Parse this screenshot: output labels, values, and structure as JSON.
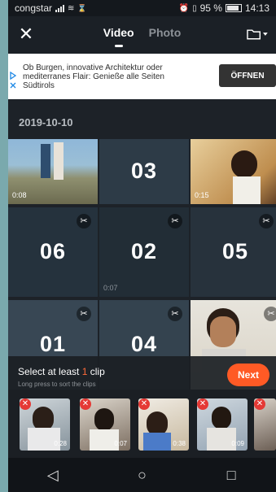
{
  "status_bar": {
    "carrier": "congstar",
    "battery_pct": "95 %",
    "time": "14:13"
  },
  "top_bar": {
    "tabs": [
      {
        "label": "Video",
        "active": true
      },
      {
        "label": "Photo",
        "active": false
      }
    ],
    "close_icon": "close-icon",
    "folder_icon": "folder-dropdown-icon"
  },
  "ad": {
    "text": "Ob Burgen, innovative Architektur oder mediterranes Flair: Genieße alle Seiten Südtirols",
    "button": "ÖFFNEN"
  },
  "date_header": "2019-10-10",
  "grid": [
    {
      "type": "photo",
      "duration": "0:08"
    },
    {
      "type": "selected",
      "number": "03"
    },
    {
      "type": "photo",
      "duration": "0:15"
    },
    {
      "type": "selected",
      "number": "06"
    },
    {
      "type": "selected",
      "number": "02"
    },
    {
      "type": "selected",
      "number": "05"
    },
    {
      "type": "selected",
      "number": "01"
    },
    {
      "type": "selected",
      "number": "04"
    },
    {
      "type": "photo",
      "duration": ""
    }
  ],
  "hidden_under_02": "0:07",
  "panel": {
    "title_prefix": "Select at least ",
    "title_highlight": "1",
    "title_suffix": " clip",
    "subtitle": "Long press to sort the clips",
    "next_label": "Next"
  },
  "clips": [
    {
      "duration": "0:28"
    },
    {
      "duration": "0:07"
    },
    {
      "duration": "0:38"
    },
    {
      "duration": "0:09"
    },
    {
      "duration": ""
    }
  ],
  "colors": {
    "accent": "#ff5a25",
    "background": "#1d2228",
    "remove_badge": "#e53935"
  }
}
